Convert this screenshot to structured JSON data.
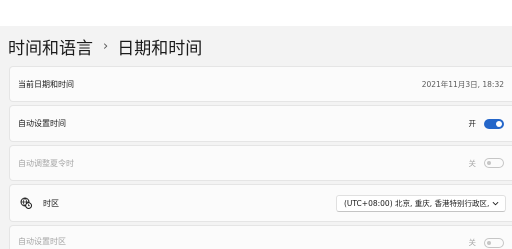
{
  "breadcrumb": {
    "parent": "时间和语言",
    "separator": "›",
    "current": "日期和时间"
  },
  "rows": {
    "current_datetime": {
      "label": "当前日期和时间",
      "value": "2021年11月3日, 18:32"
    },
    "auto_time": {
      "label": "自动设置时间",
      "state_text": "开",
      "on": true
    },
    "auto_dst": {
      "label": "自动调整夏令时",
      "state_text": "关",
      "on": false,
      "disabled": true
    },
    "timezone": {
      "icon": "globe-clock-icon",
      "label": "时区",
      "value": "(UTC+08:00) 北京, 重庆, 香港特别行政区,"
    },
    "auto_timezone": {
      "label": "自动设置时区",
      "state_text": "关",
      "on": false,
      "disabled": true
    }
  },
  "colors": {
    "accent": "#2466c9",
    "background": "#f3f3f3",
    "card": "#fbfbfb"
  }
}
